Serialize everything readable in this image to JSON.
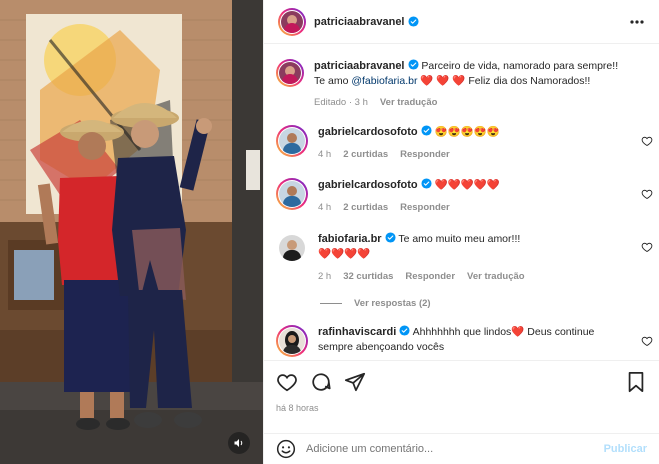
{
  "post": {
    "author": "patriciaabravanel",
    "caption_line1_pre": "Parceiro de vida, namorado para sempre!!",
    "caption_line2_pre": "Te amo",
    "caption_mention": "@fabiofaria.br",
    "caption_hearts": "❤️ ❤️ ❤️",
    "caption_line2_post": "Feliz dia dos Namorados!!",
    "edited": "Editado · 3 h",
    "see_translation": "Ver tradução"
  },
  "comments": [
    {
      "user": "gabrielcardosofoto",
      "text": "😍😍😍😍😍",
      "time": "4 h",
      "likes": "2 curtidas",
      "reply": "Responder"
    },
    {
      "user": "gabrielcardosofoto",
      "text": "❤️❤️❤️❤️❤️",
      "time": "4 h",
      "likes": "2 curtidas",
      "reply": "Responder"
    },
    {
      "user": "fabiofaria.br",
      "text": "Te amo muito meu amor!!!",
      "text2": "❤️❤️❤️❤️",
      "time": "2 h",
      "likes": "32 curtidas",
      "reply": "Responder",
      "translate": "Ver tradução"
    },
    {
      "user": "rafinhaviscardi",
      "text": "Ahhhhhhh que lindos❤️ Deus continue",
      "text2": "sempre abençoando vocês"
    }
  ],
  "view_replies": "Ver respostas (2)",
  "time_ago": "há 8 horas",
  "add_comment": {
    "placeholder": "Adicione um comentário...",
    "post_label": "Publicar"
  },
  "icons": {
    "verified": "verified-badge-icon",
    "more": "more-options-icon",
    "like": "heart-icon",
    "comment": "comment-icon",
    "share": "share-icon",
    "save": "bookmark-icon",
    "emoji": "emoji-icon",
    "mute": "speaker-icon"
  },
  "colors": {
    "verified": "#0095f6",
    "mention": "#00376b",
    "muted": "#8e8e8e",
    "post_disabled": "#b2dffc"
  }
}
